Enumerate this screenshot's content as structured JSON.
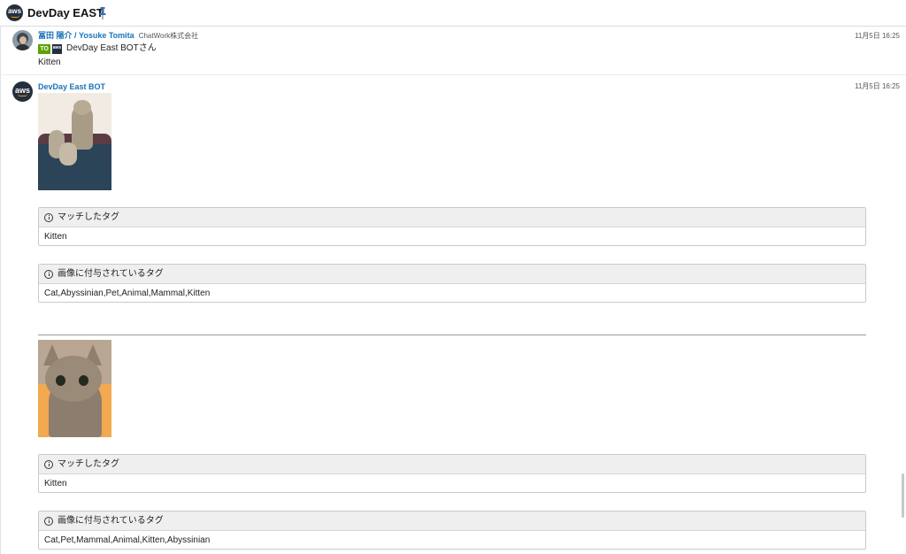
{
  "header": {
    "room_name": "DevDay EAST",
    "room_icon_label": "aws",
    "pin_icon": "pin-icon"
  },
  "messages": [
    {
      "sender": "冨田 陽介 / Yosuke Tomita",
      "org": "ChatWork株式会社",
      "timestamp": "11月5日 16:25",
      "to_badge": "TO",
      "to_avatar_label": "aws",
      "to_name": "DevDay East BOTさん",
      "text": "Kitten"
    },
    {
      "sender": "DevDay East BOT",
      "avatar_label": "aws",
      "timestamp": "11月5日 16:25",
      "results": [
        {
          "matched_title": "マッチしたタグ",
          "matched_value": "Kitten",
          "tags_title": "画像に付与されているタグ",
          "tags_value": "Cat,Abyssinian,Pet,Animal,Mammal,Kitten"
        },
        {
          "matched_title": "マッチしたタグ",
          "matched_value": "Kitten",
          "tags_title": "画像に付与されているタグ",
          "tags_value": "Cat,Pet,Mammal,Animal,Kitten,Abyssinian"
        }
      ]
    }
  ],
  "colors": {
    "sender_link": "#1a73b8",
    "to_badge": "#5aa300",
    "aws_dark": "#232f3e",
    "aws_orange": "#ff9900"
  }
}
